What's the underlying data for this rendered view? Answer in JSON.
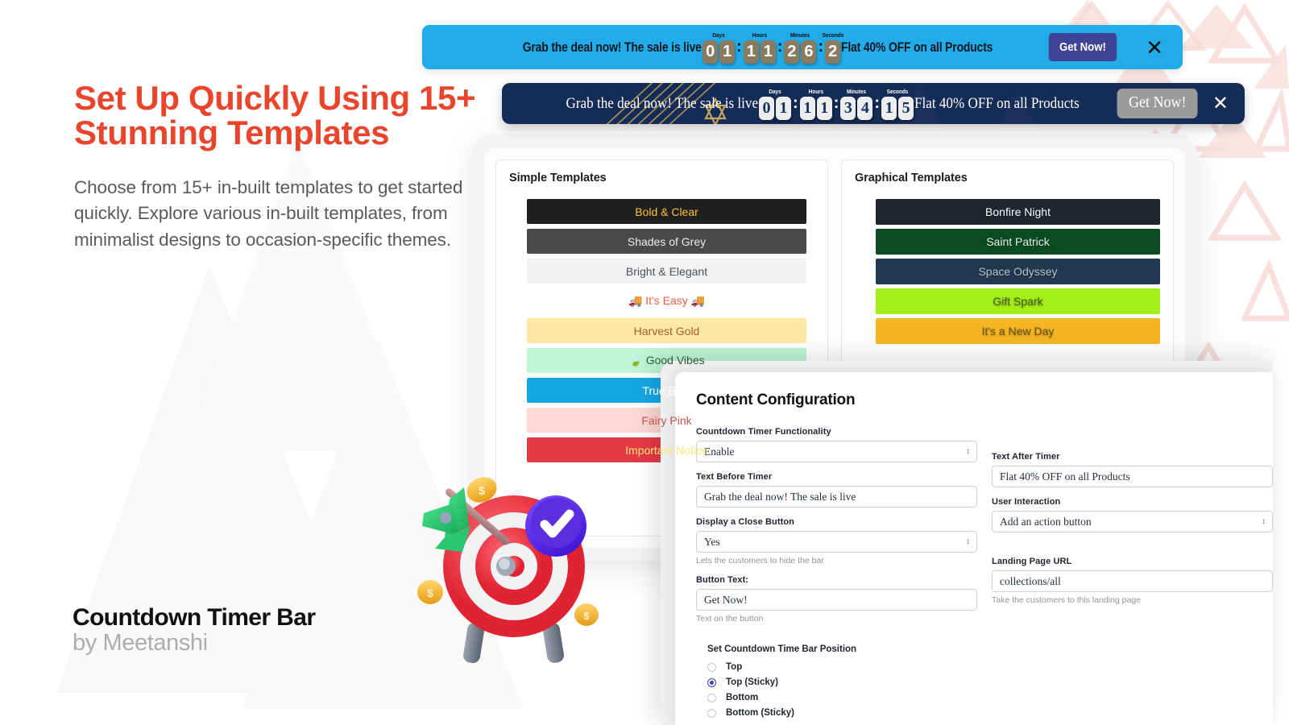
{
  "hero": {
    "headline": "Set Up Quickly Using 15+ Stunning Templates",
    "body": "Choose from 15+ in-built templates to get started quickly. Explore various in-built templates, from minimalist designs to occasion-specific themes.",
    "headline_color": "#E8452C"
  },
  "brand": {
    "title": "Countdown Timer Bar",
    "subtitle": "by Meetanshi"
  },
  "bars": [
    {
      "id": "blue",
      "text_before": "Grab the deal now! The sale is live",
      "text_after": "Flat 40% OFF on all Products",
      "cta_label": "Get Now!",
      "close_icon": "✕",
      "background": "#22ABE9",
      "cta_background": "#3D4395",
      "digit_background": "#8A7A5E",
      "timer": {
        "labels": [
          "Days",
          "Hours",
          "Minutes",
          "Seconds"
        ],
        "days": "01",
        "hours": "11",
        "minutes": "26",
        "seconds": "2",
        "separator": ":"
      }
    },
    {
      "id": "dark",
      "text_before": "Grab the deal now! The sale is live",
      "text_after": "Flat 40% OFF on all Products",
      "cta_label": "Get Now!",
      "close_icon": "✕",
      "background": "#152C56",
      "cta_background": "#9B9B9B",
      "digit_background": "#ECEDEF",
      "timer": {
        "labels": [
          "Days",
          "Hours",
          "Minutes",
          "Seconds"
        ],
        "days": "01",
        "hours": "11",
        "minutes": "34",
        "seconds": "15",
        "separator": ":"
      }
    }
  ],
  "templates_panel": {
    "simple": {
      "title": "Simple Templates",
      "items": [
        {
          "label": "Bold & Clear",
          "bg": "#1F1F1F",
          "color": "#FFC232"
        },
        {
          "label": "Shades of Grey",
          "bg": "#4A4A4A",
          "color": "#EDEDED"
        },
        {
          "label": "Bright & Elegant",
          "bg": "#F2F2F2",
          "color": "#4A5360"
        },
        {
          "label": "🚚 It's Easy 🚚",
          "bg": "transparent",
          "color": "#F05A45"
        },
        {
          "label": "Harvest Gold",
          "bg": "#FCE9A8",
          "color": "#A85A2A"
        },
        {
          "label": "🍃 Good Vibes",
          "bg": "#BFF5D4",
          "color": "#2C5B3C"
        },
        {
          "label": "True Blue",
          "bg": "#14A7E3",
          "color": "#FFFFFF"
        },
        {
          "label": "Fairy Pink",
          "bg": "#FDD8D4",
          "color": "#C4544C"
        },
        {
          "label": "Important Notice",
          "bg": "#E63946",
          "color": "#FFE57A"
        }
      ]
    },
    "graphical": {
      "title": "Graphical Templates",
      "items": [
        {
          "label": "Bonfire Night",
          "bg": "#20252E",
          "color": "#FFFFFF"
        },
        {
          "label": "Saint Patrick",
          "bg": "#0B4B21",
          "color": "#E7F5EA"
        },
        {
          "label": "Space Odyssey",
          "bg": "#20394F",
          "color": "#B9C3CC"
        },
        {
          "label": "Gift Spark",
          "bg": "#A4EE17",
          "color": "#4A5A21"
        },
        {
          "label": "It's a New Day",
          "bg": "#F5B522",
          "color": "#6A5418"
        }
      ]
    }
  },
  "config": {
    "title": "Content Configuration",
    "fields": {
      "functionality": {
        "label": "Countdown Timer Functionality",
        "value": "Enable",
        "type": "select"
      },
      "text_before": {
        "label": "Text Before Timer",
        "value": "Grab the deal now! The sale is live",
        "type": "text"
      },
      "text_after": {
        "label": "Text After Timer",
        "value": "Flat 40% OFF on all Products",
        "type": "text"
      },
      "close_button": {
        "label": "Display a Close Button",
        "value": "Yes",
        "type": "select",
        "help": "Lets the customers to hide the bar"
      },
      "user_interaction": {
        "label": "User Interaction",
        "value": "Add an action button",
        "type": "select"
      },
      "button_text": {
        "label": "Button Text:",
        "value": "Get Now!",
        "type": "text",
        "help": "Text on the button"
      },
      "landing_url": {
        "label": "Landing Page URL",
        "value": "collections/all",
        "type": "text",
        "help": "Take the customers to this landing page"
      }
    },
    "position_group": {
      "label": "Set Countdown Time Bar Position",
      "selected": "Top (Sticky)",
      "options": [
        "Top",
        "Top (Sticky)",
        "Bottom",
        "Bottom (Sticky)"
      ],
      "accent": "#3B3FB6"
    }
  },
  "illustration": {
    "name": "target-dartboard-with-dart",
    "accents": {
      "target_red": "#EE3B46",
      "dart_green": "#2FC46B",
      "check_purple": "#5B2FE0",
      "coin_gold": "#F4B731"
    }
  }
}
